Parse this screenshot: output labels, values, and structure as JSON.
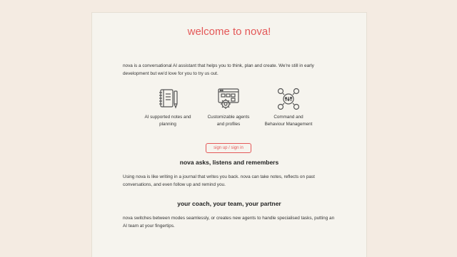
{
  "page": {
    "title": "welcome to nova!",
    "intro": "nova is a conversational AI assistant that helps you to think, plan and create. We're still in early development but we'd love for you to try us out."
  },
  "features": [
    {
      "icon": "notebook-pen-icon",
      "label": "AI supported notes and planning"
    },
    {
      "icon": "gears-window-icon",
      "label": "Customizable agents and profiles"
    },
    {
      "icon": "command-network-icon",
      "label": "Command and Behaviour Management"
    }
  ],
  "auth": {
    "button_label": "sign up / sign in"
  },
  "sections": [
    {
      "heading": "nova asks, listens and remembers",
      "body": "Using nova is like writing in a journal that writes you back. nova can take notes, reflects on past conversations, and even follow up and remind you."
    },
    {
      "heading": "your coach, your team, your partner",
      "body": "nova switches between modes seamlessly, or creates new agents to handle specialised tasks, putting an AI team at your fingertips."
    }
  ],
  "colors": {
    "accent": "#e45858",
    "background": "#f4ebe2",
    "card": "#f6f4ee",
    "icon": "#555555"
  }
}
